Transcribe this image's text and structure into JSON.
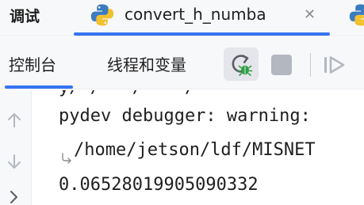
{
  "tabbar": {
    "debug_label": "调试",
    "file_tab": {
      "label": "convert_h_numba",
      "icon": "python-icon",
      "close_icon": "close-icon"
    },
    "extra_tab_icon": "python-icon"
  },
  "toolbar": {
    "tabs": [
      {
        "label": "控制台",
        "selected": true
      },
      {
        "label": "线程和变量",
        "selected": false
      }
    ],
    "buttons": {
      "rerun": "rerun-debug-icon",
      "stop": "stop-icon",
      "resume": "resume-program-icon"
    }
  },
  "gutter": {
    "icons": [
      "up-arrow-icon",
      "down-arrow-icon",
      "expand-icon"
    ]
  },
  "console": {
    "lines": [
      "pydev debugger: warning:",
      "/home/jetson/ldf/MISNET",
      "0.06528019905090332"
    ]
  },
  "colors": {
    "accent": "#3574f0",
    "python_blue": "#3b7bbf",
    "python_yellow": "#f2c12e",
    "debug_green": "#2f9e44",
    "panel_bg": "#f7f8fa"
  }
}
